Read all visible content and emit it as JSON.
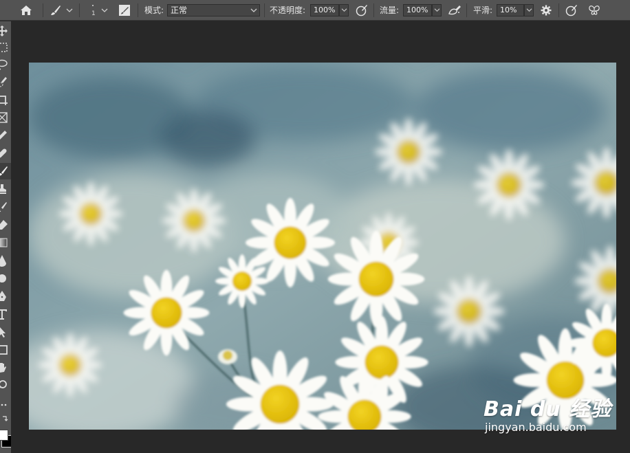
{
  "toolbar": {
    "brush_size": "1",
    "mode_label": "模式:",
    "mode_value": "正常",
    "opacity_label": "不透明度:",
    "opacity_value": "100%",
    "flow_label": "流量:",
    "flow_value": "100%",
    "smoothing_label": "平滑:",
    "smoothing_value": "10%"
  },
  "tools": [
    "move-icon",
    "marquee-icon",
    "lasso-icon",
    "quick-select-icon",
    "crop-icon",
    "frame-icon",
    "eyedropper-icon",
    "healing-icon",
    "brush-icon",
    "stamp-icon",
    "history-brush-icon",
    "eraser-icon",
    "gradient-icon",
    "blur-icon",
    "dodge-icon",
    "pen-icon",
    "type-icon",
    "path-select-icon",
    "shape-icon",
    "hand-icon",
    "zoom-icon",
    "more-icon",
    "swap-colors-icon",
    "color-swatches-icon"
  ],
  "active_tool": "brush-icon",
  "watermark": {
    "logo": "Bai du 经验",
    "url": "jingyan.baidu.com"
  },
  "colors": {
    "ui_panel": "#535353",
    "workspace": "#282828",
    "flower_center": "#e8c20a"
  }
}
